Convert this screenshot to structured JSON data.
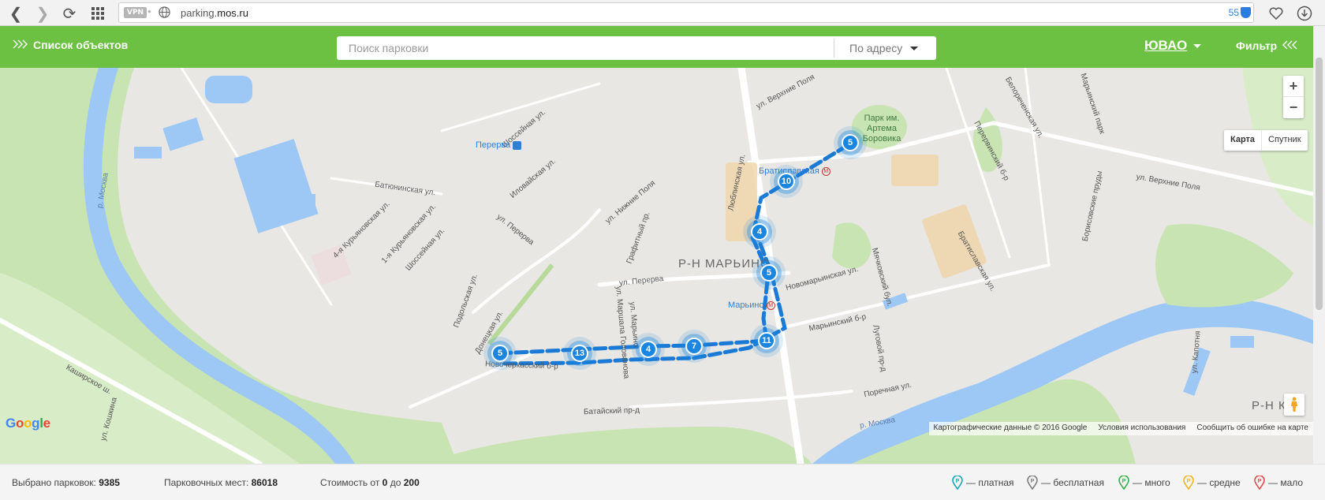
{
  "browser": {
    "vpn_label": "VPN",
    "url_prefix": "parking.",
    "url_domain": "mos.ru",
    "badge_count": "55"
  },
  "header": {
    "list_label": "Список объектов",
    "search_placeholder": "Поиск парковки",
    "search_mode": "По адресу",
    "region": "ЮВАО",
    "filter_label": "Фильтр"
  },
  "map": {
    "zoom_in": "+",
    "zoom_out": "−",
    "type_map": "Карта",
    "type_satellite": "Спутник",
    "district_label": "Р-Н МАРЬИНО",
    "district_label_2": "Р-Н КАП",
    "metro_1": "Перерва",
    "metro_2": "Братиславская",
    "metro_3": "Марьино",
    "park_label": "Парк им. Артема Боровика",
    "river_label": "р. Москва",
    "river_label_2": "р. Москва",
    "streets": [
      "Шоссейная ул.",
      "Иловайская ул.",
      "Батюнинская ул.",
      "4-я Курьяновская ул.",
      "1-я Курьяновская ул.",
      "Шоссейная ул.",
      "ул. Нижние Поля",
      "ул. Перерва",
      "Графитный пр.",
      "Подольская ул.",
      "ул. Перерва",
      "ул. Маршала Голованова",
      "ул. Марьино",
      "Люблинская ул.",
      "ул. Верхние Поля",
      "Белореченская ул.",
      "Перервинский б-р",
      "Братиславская ул.",
      "Мячковский бул.",
      "Новомарьинская ул.",
      "Марьинский б-р",
      "Луговой пр-д",
      "Поречная ул.",
      "Батайский пр-д",
      "Каширское ш.",
      "ул. Кошкина",
      "Донецкая ул.",
      "Новочеркасский б-р",
      "ул. Верхние Поля",
      "ул. Капотня",
      "Борисовские пруды",
      "Марьинский парк"
    ],
    "attribution": "Картографические данные © 2016 Google",
    "terms": "Условия использования",
    "report": "Сообщить об ошибке на карте",
    "google": [
      "G",
      "o",
      "o",
      "g",
      "l",
      "e"
    ],
    "clusters": [
      "5",
      "10",
      "4",
      "5",
      "11",
      "7",
      "4",
      "13",
      "5"
    ],
    "colors": {
      "route": "#1b7ad6",
      "cluster": "#1b86e0",
      "green": "#6cc142"
    }
  },
  "footer": {
    "selected_label": "Выбрано парковок:",
    "selected_value": "9385",
    "places_label": "Парковочных мест:",
    "places_value": "86018",
    "cost_label": "Стоимость от",
    "cost_from": "0",
    "cost_to_label": "до",
    "cost_to": "200",
    "legend": [
      {
        "letter": "P",
        "label": "— платная",
        "color": "#19a7b5"
      },
      {
        "letter": "P",
        "label": "— бесплатная",
        "color": "#7d7d7d"
      },
      {
        "letter": "P",
        "label": "— много",
        "color": "#2fb34a"
      },
      {
        "letter": "P",
        "label": "— средне",
        "color": "#f0b323"
      },
      {
        "letter": "P",
        "label": "— мало",
        "color": "#e54b4b"
      }
    ]
  }
}
